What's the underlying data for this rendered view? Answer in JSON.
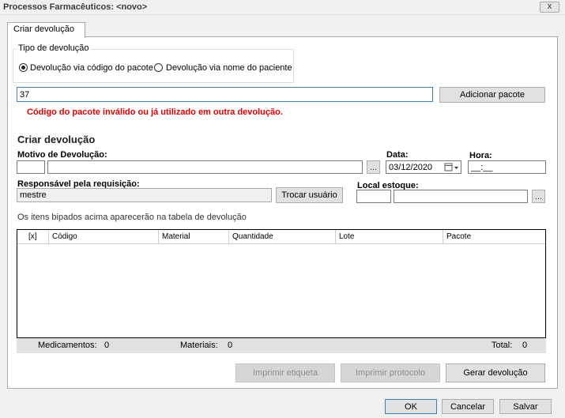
{
  "window": {
    "title": "Processos Farmacêuticos: <novo>",
    "close_glyph": "x"
  },
  "tabs": [
    {
      "label": "Criar devolução",
      "active": true
    }
  ],
  "tipo": {
    "legend": "Tipo de devolução",
    "options": [
      {
        "label": "Devolução via código do pacote",
        "checked": true
      },
      {
        "label": "Devolução via nome do paciente",
        "checked": false
      }
    ]
  },
  "pacote": {
    "value": "37",
    "add_button": "Adicionar pacote",
    "error": "Código do pacote inválido ou já utilizado em outra devolução."
  },
  "form": {
    "section_title": "Criar devolução",
    "motivo_label": "Motivo de Devolução:",
    "motivo_code": "",
    "motivo_desc": "",
    "ellipsis": "...",
    "data_label": "Data:",
    "data_value": "03/12/2020",
    "hora_label": "Hora:",
    "hora_value": "__:__",
    "responsavel_label": "Responsável pela requisição:",
    "responsavel_value": "mestre",
    "trocar_button": "Trocar usuário",
    "local_label": "Local estoque:",
    "local_code": "",
    "local_desc": "",
    "hint": "Os itens bipados acima aparecerão na tabela de devolução"
  },
  "table": {
    "columns": [
      "[x]",
      "Código",
      "Material",
      "Quantidade",
      "Lote",
      "Pacote"
    ],
    "rows": []
  },
  "summary": {
    "medicamentos_label": "Medicamentos:",
    "medicamentos_value": "0",
    "materiais_label": "Materiais:",
    "materiais_value": "0",
    "total_label": "Total:",
    "total_value": "0"
  },
  "actions": {
    "imprimir_etiqueta": "Imprimir etiqueta",
    "imprimir_protocolo": "Imprimir protocolo",
    "gerar": "Gerar devolução"
  },
  "footer": {
    "ok": "OK",
    "cancelar": "Cancelar",
    "salvar": "Salvar"
  },
  "colors": {
    "error": "#e00000",
    "focus_border": "#3c7fb1",
    "window_bg": "#f0f0f0"
  }
}
